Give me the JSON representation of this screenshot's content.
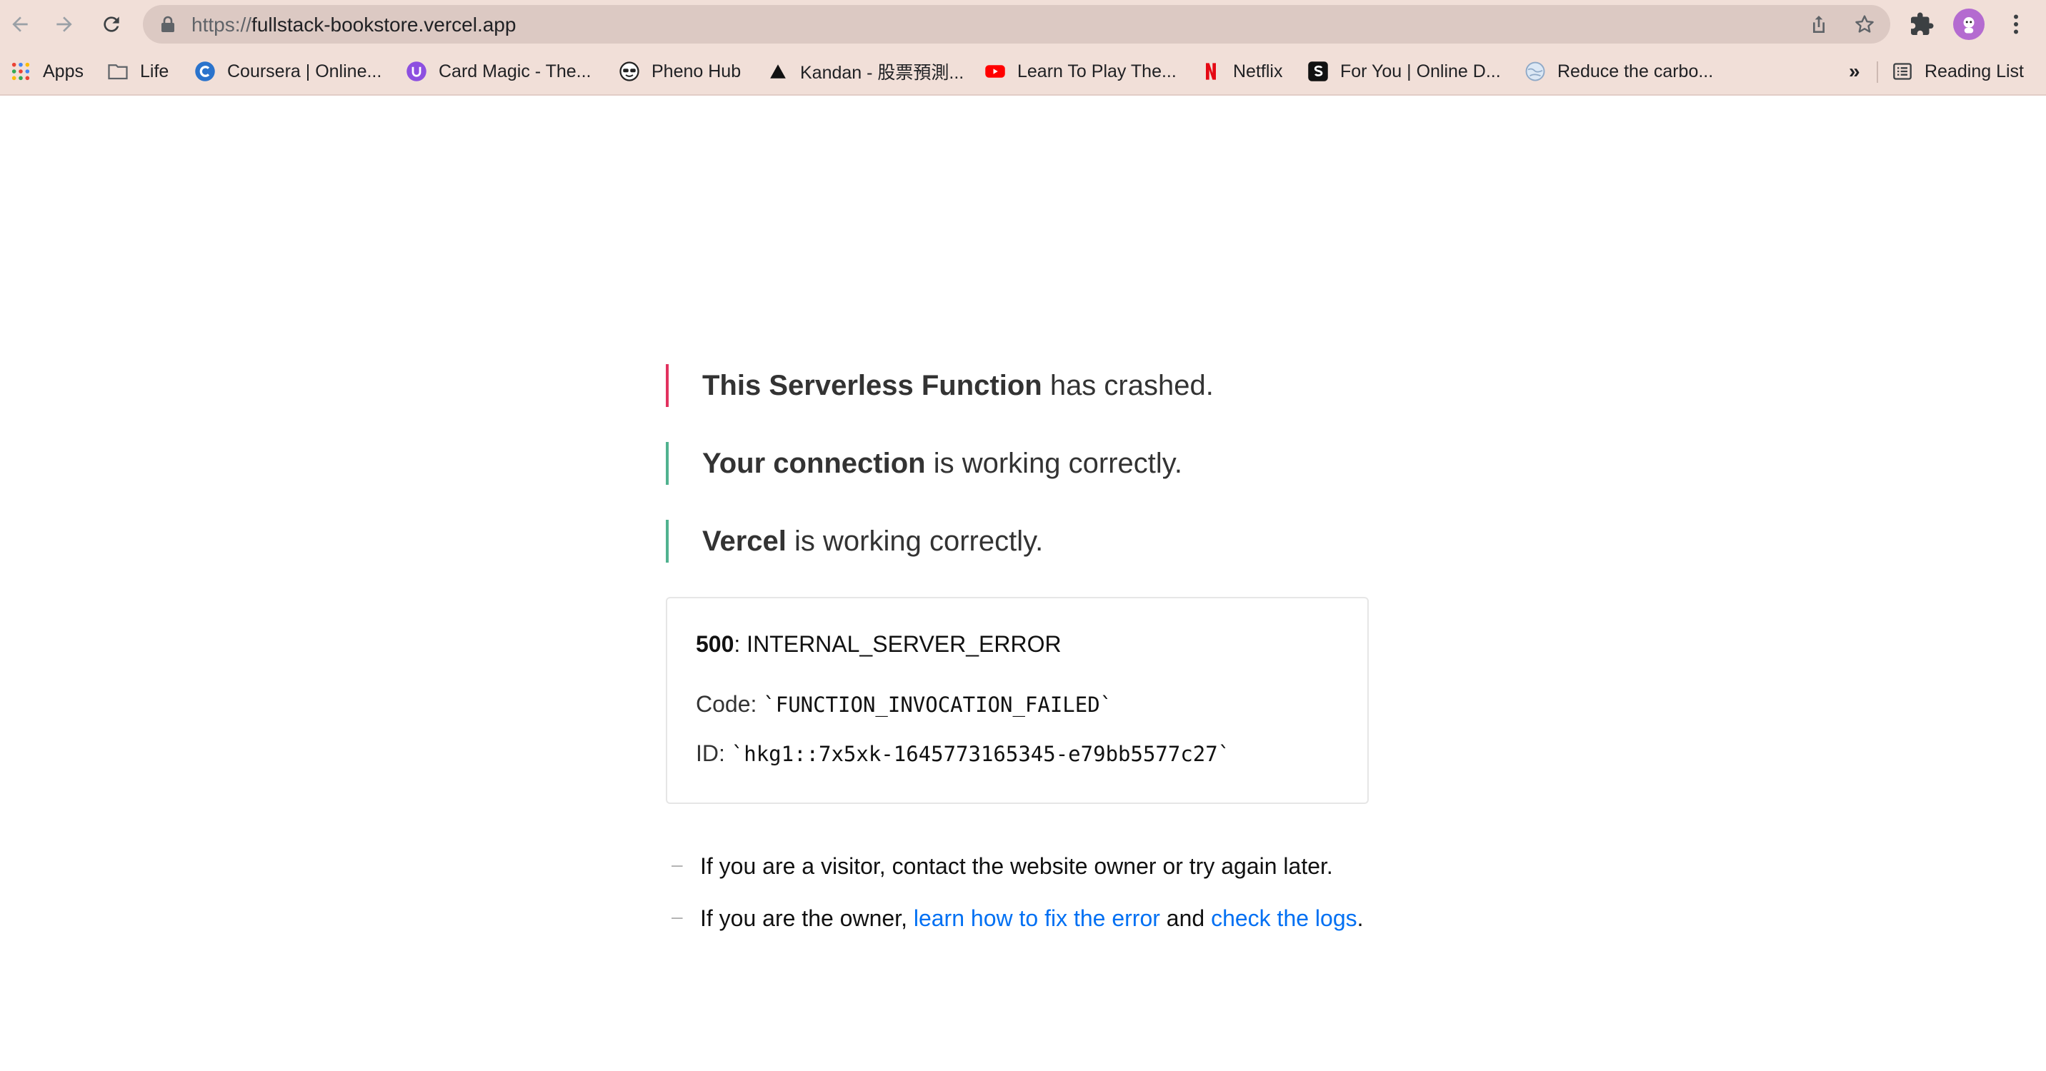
{
  "browser": {
    "url_scheme": "https://",
    "url_host": "fullstack-bookstore.vercel.app",
    "bookmarks": [
      {
        "label": "Apps",
        "icon": "apps-grid-icon"
      },
      {
        "label": "Life",
        "icon": "folder-icon"
      },
      {
        "label": "Coursera | Online...",
        "icon": "coursera-icon"
      },
      {
        "label": "Card Magic - The...",
        "icon": "card-magic-icon"
      },
      {
        "label": "Pheno Hub",
        "icon": "pheno-hub-icon"
      },
      {
        "label": "Kandan - 股票預測...",
        "icon": "kandan-icon"
      },
      {
        "label": "Learn To Play The...",
        "icon": "youtube-icon"
      },
      {
        "label": "Netflix",
        "icon": "netflix-icon"
      },
      {
        "label": "For You | Online D...",
        "icon": "skillshare-icon"
      },
      {
        "label": "Reduce the carbo...",
        "icon": "globe-icon"
      }
    ],
    "overflow_label": "»",
    "reading_list_label": "Reading List"
  },
  "error_page": {
    "status_lines": [
      {
        "bold": "This Serverless Function",
        "rest": " has crashed.",
        "state": "error"
      },
      {
        "bold": "Your connection",
        "rest": " is working correctly.",
        "state": "ok"
      },
      {
        "bold": "Vercel",
        "rest": " is working correctly.",
        "state": "ok"
      }
    ],
    "error_box": {
      "status_code": "500",
      "status_name": ": INTERNAL_SERVER_ERROR",
      "code_label": "Code: ",
      "code_value": "`FUNCTION_INVOCATION_FAILED`",
      "id_label": "ID: ",
      "id_value": "`hkg1::7x5xk-1645773165345-e79bb5577c27`"
    },
    "help": {
      "dash": "–",
      "visitor_text": "If you are a visitor, contact the website owner or try again later.",
      "owner_prefix": "If you are the owner, ",
      "fix_link": "learn how to fix the error",
      "and_text": " and ",
      "logs_link": "check the logs",
      "period": "."
    }
  },
  "colors": {
    "chrome_bg": "#f1dfd8",
    "omnibox_bg": "#dcc9c3",
    "error_accent": "#e2325f",
    "ok_accent": "#50b28f",
    "link": "#0070f3"
  }
}
